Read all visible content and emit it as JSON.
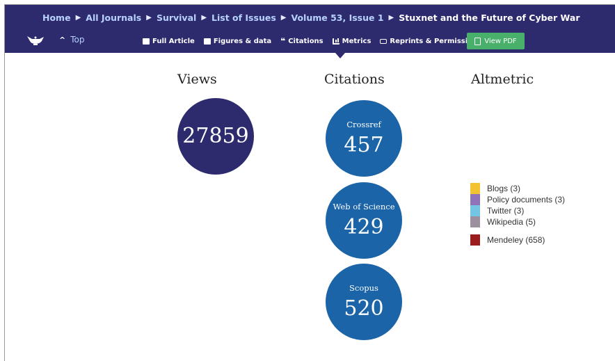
{
  "breadcrumb": {
    "items": [
      "Home",
      "All Journals",
      "Survival",
      "List of Issues",
      "Volume 53, Issue 1",
      "Stuxnet and the Future of Cyber War"
    ],
    "separator": "▶"
  },
  "subnav": {
    "logo_icon": "teapot-lamp-logo-icon",
    "top_label": "Top",
    "tabs": [
      {
        "label": "Full Article",
        "icon": "document-icon"
      },
      {
        "label": "Figures & data",
        "icon": "image-icon"
      },
      {
        "label": "Citations",
        "icon": "quote-icon"
      },
      {
        "label": "Metrics",
        "icon": "bar-chart-icon",
        "active": true
      },
      {
        "label": "Reprints & Permissions",
        "icon": "print-icon"
      }
    ],
    "view_pdf_label": "View PDF"
  },
  "metrics": {
    "views_title": "Views",
    "views_value": "27859",
    "citations_title": "Citations",
    "citations": [
      {
        "source": "Crossref",
        "value": "457"
      },
      {
        "source": "Web of Science",
        "value": "429"
      },
      {
        "source": "Scopus",
        "value": "520"
      }
    ],
    "altmetric_title": "Altmetric",
    "altmetric_legend": [
      {
        "label": "Blogs (3)",
        "color": "#f2c232"
      },
      {
        "label": "Policy documents (3)",
        "color": "#8f72b8"
      },
      {
        "label": "Twitter (3)",
        "color": "#74c4e4"
      },
      {
        "label": "Wikipedia (5)",
        "color": "#9c909e"
      },
      {
        "label": "Mendeley (658)",
        "color": "#9b1c1c"
      }
    ]
  },
  "colors": {
    "navbar": "#2d2a6e",
    "views_circle": "#2d2a6e",
    "citation_circle": "#1b64a8",
    "view_pdf_button": "#48b06a",
    "breadcrumb_link": "#b8d2ff"
  }
}
